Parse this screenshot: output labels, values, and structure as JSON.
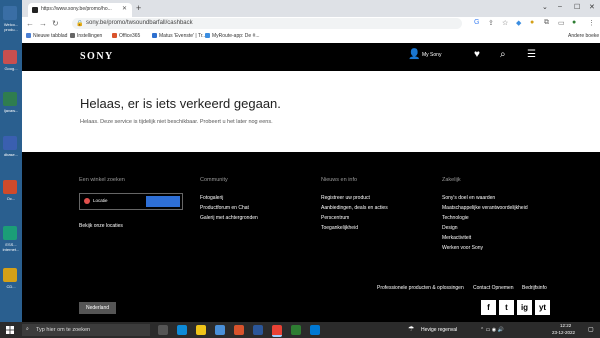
{
  "desktop": {
    "icons": [
      {
        "label": "Welco... produ...",
        "color": "#3a6ea5"
      },
      {
        "label": "Goog...",
        "color": "#c94f4f"
      },
      {
        "label": "Ijavaw...",
        "color": "#2f7d4f"
      },
      {
        "label": "dbase...",
        "color": "#3a5fb0"
      },
      {
        "label": "Oc...",
        "color": "#d04a2a"
      },
      {
        "label": "ESS... internet...",
        "color": "#1b9e77"
      },
      {
        "label": "CD...",
        "color": "#d4a017"
      }
    ]
  },
  "browser": {
    "tab_title": "https://www.sony.be/promo/ho...",
    "url": "sony.be/promo/twsoundbarfall/cashback",
    "bookmarks": [
      {
        "label": "Nieuwe tabblad",
        "color": "#4a7fd4"
      },
      {
        "label": "Instellingen",
        "color": "#666666"
      },
      {
        "label": "Office365",
        "color": "#d9532c"
      },
      {
        "label": "Matus 'Evenste' | Tr...",
        "color": "#2d6fcf"
      },
      {
        "label": "MyRoute-app: De #...",
        "color": "#3b8de0"
      }
    ],
    "other_bookmarks": "Andere boeke"
  },
  "sony": {
    "logo": "SONY",
    "my_sony": "My Sony"
  },
  "error": {
    "title": "Helaas, er is iets verkeerd gegaan.",
    "text": "Helaas. Deze service is tijdelijk niet beschikbaar. Probeert u het later nog eens."
  },
  "footer": {
    "col1": {
      "heading": "Een winkel zoeken",
      "location_label": "Locatie",
      "link": "Bekijk onze locaties"
    },
    "col2": {
      "heading": "Community",
      "items": [
        "Fotogalerij",
        "Productforum en Chat",
        "Galerij met achtergronden"
      ]
    },
    "col3": {
      "heading": "Nieuws en info",
      "items": [
        "Registreer uw product",
        "Aanbiedingen, deals en acties",
        "Perscentrum",
        "Toegankelijkheid"
      ]
    },
    "col4": {
      "heading": "Zakelijk",
      "items": [
        "Sony's doel en waarden",
        "Maatschappelijke verantwoordelijkheid",
        "Technologie",
        "Design",
        "Merkactiviteit",
        "Werken voor Sony"
      ]
    },
    "bottom_links": [
      "Professionele producten & oplossingen",
      "Contact Opnemen",
      "Bedrijfsinfo"
    ],
    "language": "Nederland",
    "social": [
      "f",
      "t",
      "ig",
      "yt"
    ]
  },
  "taskbar": {
    "search_placeholder": "Typ hier om te zoeken",
    "weather": "Hevige regenval",
    "time": "12:22",
    "date": "23-12-2022"
  }
}
